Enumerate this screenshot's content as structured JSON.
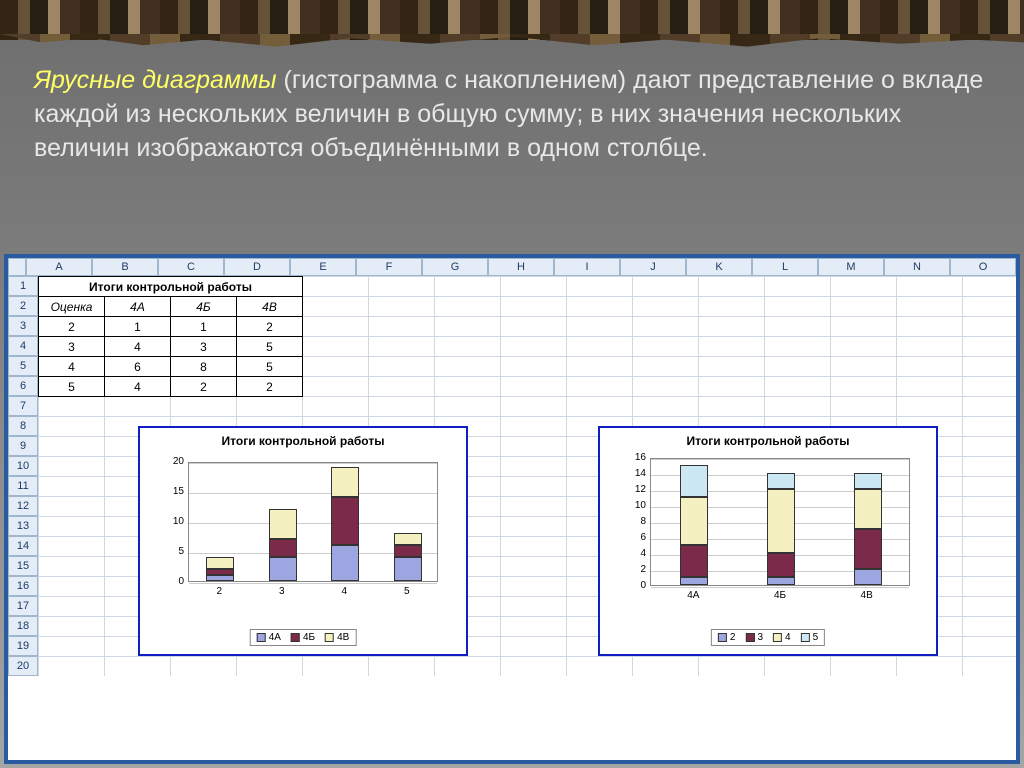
{
  "description": {
    "emph": "Ярусные диаграммы",
    "rest": " (гистограмма с накоплением) дают представление о вкладе каждой из нескольких величин в общую сумму; в них значения нескольких величин изображаются объединёнными в одном столбце."
  },
  "columns": [
    "A",
    "B",
    "C",
    "D",
    "E",
    "F",
    "G",
    "H",
    "I",
    "J",
    "K",
    "L",
    "M",
    "N",
    "O"
  ],
  "row_numbers": [
    1,
    2,
    3,
    4,
    5,
    6,
    7,
    8,
    9,
    10,
    11,
    12,
    13,
    14,
    15,
    16,
    17,
    18,
    19,
    20
  ],
  "table": {
    "title": "Итоги контрольной работы",
    "headers": [
      "Оценка",
      "4А",
      "4Б",
      "4В"
    ],
    "rows": [
      [
        "2",
        "1",
        "1",
        "2"
      ],
      [
        "3",
        "4",
        "3",
        "5"
      ],
      [
        "4",
        "6",
        "8",
        "5"
      ],
      [
        "5",
        "4",
        "2",
        "2"
      ]
    ]
  },
  "chart_data": [
    {
      "type": "bar",
      "stacked": true,
      "title": "Итоги контрольной работы",
      "categories": [
        "2",
        "3",
        "4",
        "5"
      ],
      "series": [
        {
          "name": "4А",
          "values": [
            1,
            4,
            6,
            4
          ]
        },
        {
          "name": "4Б",
          "values": [
            1,
            3,
            8,
            2
          ]
        },
        {
          "name": "4В",
          "values": [
            2,
            5,
            5,
            2
          ]
        }
      ],
      "ylim": [
        0,
        20
      ],
      "yticks": [
        0,
        5,
        10,
        15,
        20
      ],
      "legend": [
        "4А",
        "4Б",
        "4В"
      ]
    },
    {
      "type": "bar",
      "stacked": true,
      "title": "Итоги контрольной работы",
      "categories": [
        "4А",
        "4Б",
        "4В"
      ],
      "series": [
        {
          "name": "2",
          "values": [
            1,
            1,
            2
          ]
        },
        {
          "name": "3",
          "values": [
            4,
            3,
            5
          ]
        },
        {
          "name": "4",
          "values": [
            6,
            8,
            5
          ]
        },
        {
          "name": "5",
          "values": [
            4,
            2,
            2
          ]
        }
      ],
      "ylim": [
        0,
        16
      ],
      "yticks": [
        0,
        2,
        4,
        6,
        8,
        10,
        12,
        14,
        16
      ],
      "legend": [
        "2",
        "3",
        "4",
        "5"
      ]
    }
  ]
}
